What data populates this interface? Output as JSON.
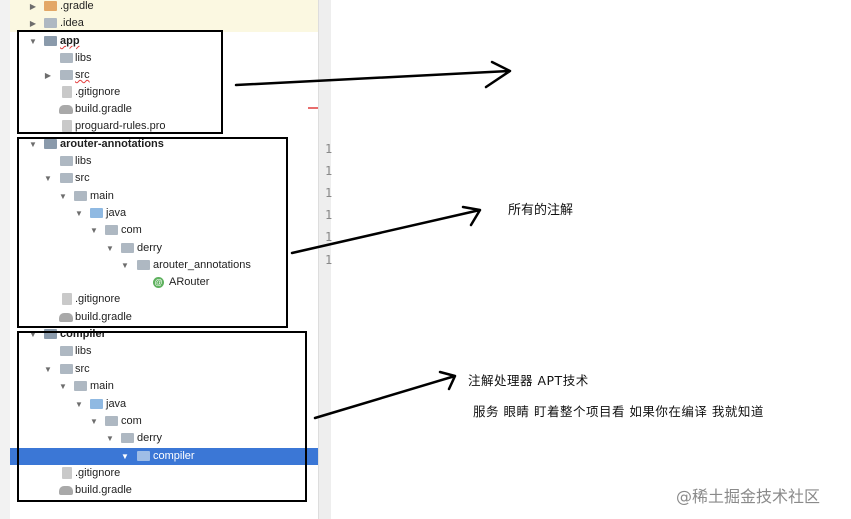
{
  "tree": {
    "rows": [
      {
        "label": ".gradle",
        "arrow": "▶",
        "icon": "folder-orange-icon"
      },
      {
        "label": ".idea",
        "arrow": "▶",
        "icon": "folder-icon"
      },
      {
        "label": "app",
        "arrow": "▼",
        "icon": "module-icon"
      },
      {
        "label": "libs",
        "arrow": "",
        "icon": "folder-icon"
      },
      {
        "label": "src",
        "arrow": "▶",
        "icon": "folder-icon"
      },
      {
        "label": ".gitignore",
        "arrow": "",
        "icon": "file-icon"
      },
      {
        "label": "build.gradle",
        "arrow": "",
        "icon": "gradle-icon"
      },
      {
        "label": "proguard-rules.pro",
        "arrow": "",
        "icon": "file-icon"
      },
      {
        "label": "arouter-annotations",
        "arrow": "▼",
        "icon": "module-icon"
      },
      {
        "label": "libs",
        "arrow": "",
        "icon": "folder-icon"
      },
      {
        "label": "src",
        "arrow": "▼",
        "icon": "folder-icon"
      },
      {
        "label": "main",
        "arrow": "▼",
        "icon": "folder-icon"
      },
      {
        "label": "java",
        "arrow": "▼",
        "icon": "folder-blue-icon"
      },
      {
        "label": "com",
        "arrow": "▼",
        "icon": "package-icon"
      },
      {
        "label": "derry",
        "arrow": "▼",
        "icon": "package-icon"
      },
      {
        "label": "arouter_annotations",
        "arrow": "▼",
        "icon": "package-icon"
      },
      {
        "label": "ARouter",
        "arrow": "",
        "icon": "annotation-icon"
      },
      {
        "label": ".gitignore",
        "arrow": "",
        "icon": "file-icon"
      },
      {
        "label": "build.gradle",
        "arrow": "",
        "icon": "gradle-icon"
      },
      {
        "label": "compiler",
        "arrow": "▼",
        "icon": "module-icon"
      },
      {
        "label": "libs",
        "arrow": "",
        "icon": "folder-icon"
      },
      {
        "label": "src",
        "arrow": "▼",
        "icon": "folder-icon"
      },
      {
        "label": "main",
        "arrow": "▼",
        "icon": "folder-icon"
      },
      {
        "label": "java",
        "arrow": "▼",
        "icon": "folder-blue-icon"
      },
      {
        "label": "com",
        "arrow": "▼",
        "icon": "package-icon"
      },
      {
        "label": "derry",
        "arrow": "▼",
        "icon": "package-icon"
      },
      {
        "label": "compiler",
        "arrow": "▼",
        "icon": "package-icon"
      },
      {
        "label": ".gitignore",
        "arrow": "",
        "icon": "file-icon"
      },
      {
        "label": "build.gradle",
        "arrow": "",
        "icon": "gradle-icon"
      }
    ],
    "selected_label": "compiler",
    "annotation_glyph": "@"
  },
  "editor": {
    "line_numbers": [
      "1",
      "1",
      "1",
      "1",
      "1",
      "1"
    ]
  },
  "annotations": {
    "note_all_annotations": "所有的注解",
    "note_apt": "注解处理器 APT技术",
    "note_services": "服务 眼睛 盯着整个项目看 如果你在编译 我就知道"
  },
  "watermark": "@稀土掘金技术社区",
  "colors": {
    "selection": "#3b77d6",
    "annotation_box": "#000000",
    "module_dot": "#3ab54a"
  }
}
